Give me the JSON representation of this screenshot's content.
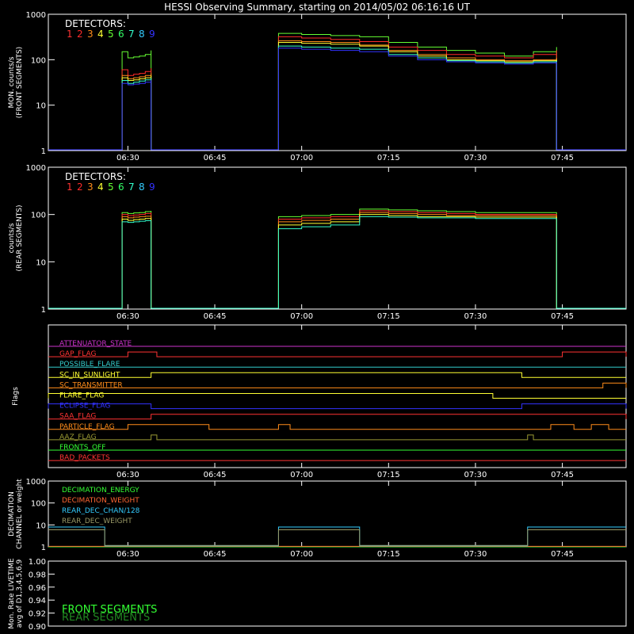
{
  "title": "HESSI Observing Summary, starting on 2014/05/02 06:16:16 UT",
  "time_ticks": [
    "06:30",
    "06:45",
    "07:00",
    "07:15",
    "07:30",
    "07:45"
  ],
  "detector_colors": [
    "#ff3333",
    "#ff2a2a",
    "#ff8c1a",
    "#ffff33",
    "#66ff33",
    "#33ff66",
    "#33ffcc",
    "#33ccff",
    "#3333ff"
  ],
  "detectors_label": "DETECTORS:",
  "detector_numbers": [
    "1",
    "2",
    "3",
    "4",
    "5",
    "6",
    "7",
    "8",
    "9"
  ],
  "chart_data": [
    {
      "type": "line",
      "panel": "front",
      "ylabel": [
        "MON. counts/s",
        "(FRONT SEGMENTS)"
      ],
      "yscale": "log",
      "ylim": [
        1,
        1000
      ],
      "ytick_labels": [
        "1",
        "10",
        "100",
        "1000"
      ],
      "xlim": [
        "06:16:16",
        "07:56"
      ],
      "x": [
        "06:29",
        "06:30",
        "06:31",
        "06:32",
        "06:33",
        "06:34",
        "06:57",
        "07:00",
        "07:05",
        "07:10",
        "07:15",
        "07:20",
        "07:25",
        "07:30",
        "07:35",
        "07:40",
        "07:44"
      ],
      "series": [
        {
          "values": [
            150,
            110,
            115,
            120,
            130,
            160,
            380,
            360,
            340,
            320,
            240,
            190,
            160,
            140,
            120,
            150,
            190
          ]
        },
        {
          "values": [
            60,
            45,
            48,
            50,
            55,
            65,
            320,
            300,
            280,
            250,
            190,
            160,
            130,
            120,
            110,
            130,
            160
          ]
        },
        {
          "values": [
            45,
            38,
            40,
            42,
            45,
            50,
            260,
            250,
            240,
            210,
            160,
            130,
            110,
            100,
            95,
            100,
            110
          ]
        },
        {
          "values": [
            40,
            35,
            36,
            38,
            40,
            45,
            240,
            230,
            220,
            200,
            150,
            120,
            100,
            95,
            90,
            95,
            100
          ]
        },
        {
          "values": [
            35,
            30,
            32,
            34,
            36,
            40,
            200,
            190,
            180,
            170,
            130,
            110,
            95,
            90,
            85,
            90,
            95
          ]
        },
        {
          "values": [
            30,
            28,
            29,
            30,
            32,
            36,
            180,
            170,
            160,
            150,
            120,
            100,
            90,
            85,
            80,
            85,
            90
          ]
        }
      ]
    },
    {
      "type": "line",
      "panel": "rear",
      "ylabel": [
        "counts/s",
        "(REAR SEGMENTS)"
      ],
      "yscale": "log",
      "ylim": [
        1,
        1000
      ],
      "ytick_labels": [
        "1",
        "10",
        "100",
        "1000"
      ],
      "xlim": [
        "06:16:16",
        "07:56"
      ],
      "x": [
        "06:29",
        "06:30",
        "06:31",
        "06:32",
        "06:33",
        "06:34",
        "06:57",
        "07:00",
        "07:05",
        "07:10",
        "07:15",
        "07:20",
        "07:25",
        "07:30",
        "07:35",
        "07:40",
        "07:44"
      ],
      "series": [
        {
          "values": [
            110,
            105,
            108,
            110,
            115,
            120,
            90,
            95,
            100,
            130,
            125,
            120,
            115,
            110,
            110,
            110,
            75
          ]
        },
        {
          "values": [
            100,
            95,
            98,
            100,
            105,
            110,
            80,
            85,
            90,
            120,
            115,
            110,
            105,
            100,
            100,
            100,
            65
          ]
        },
        {
          "values": [
            90,
            85,
            88,
            90,
            92,
            95,
            70,
            75,
            80,
            110,
            105,
            100,
            95,
            95,
            95,
            95,
            55
          ]
        },
        {
          "values": [
            80,
            75,
            78,
            80,
            82,
            85,
            60,
            65,
            70,
            100,
            95,
            90,
            90,
            88,
            88,
            88,
            45
          ]
        },
        {
          "values": [
            70,
            68,
            70,
            72,
            74,
            76,
            50,
            55,
            60,
            90,
            88,
            85,
            85,
            82,
            82,
            82,
            35
          ]
        }
      ]
    },
    {
      "type": "line",
      "panel": "flags",
      "ylabel": [
        "Flags"
      ],
      "xlim": [
        "06:16:16",
        "07:56"
      ],
      "flags": [
        {
          "name": "ATTENUATOR_STATE",
          "color": "#cc33cc",
          "segments": []
        },
        {
          "name": "GAP_FLAG",
          "color": "#ff3333",
          "segments": [
            [
              "06:30",
              "06:35"
            ],
            [
              "07:45",
              "07:56"
            ]
          ]
        },
        {
          "name": "POSSIBLE_FLARE",
          "color": "#33cccc",
          "segments": []
        },
        {
          "name": "SC_IN_SUNLIGHT",
          "color": "#ffff33",
          "segments": [
            [
              "06:34",
              "07:38"
            ]
          ]
        },
        {
          "name": "SC_TRANSMITTER",
          "color": "#ff8c1a",
          "segments": [
            [
              "07:52",
              "07:56"
            ]
          ]
        },
        {
          "name": "FLARE_FLAG",
          "color": "#ffff33",
          "segments": [
            [
              "06:16:16",
              "07:33"
            ]
          ]
        },
        {
          "name": "ECLIPSE_FLAG",
          "color": "#3333ff",
          "segments": [
            [
              "06:16:16",
              "06:34"
            ],
            [
              "07:38",
              "07:56"
            ]
          ]
        },
        {
          "name": "SAA_FLAG",
          "color": "#ff3333",
          "segments": [
            [
              "06:34",
              "07:56"
            ]
          ]
        },
        {
          "name": "PARTICLE_FLAG",
          "color": "#ff8c1a",
          "segments": [
            [
              "06:30",
              "06:44"
            ],
            [
              "06:56",
              "06:58"
            ],
            [
              "07:43",
              "07:47"
            ],
            [
              "07:50",
              "07:53"
            ]
          ]
        },
        {
          "name": "AAZ_FLAG",
          "color": "#999933",
          "segments": [
            [
              "06:34",
              "06:35"
            ],
            [
              "07:39",
              "07:40"
            ]
          ]
        },
        {
          "name": "FRONTS_OFF",
          "color": "#33ff33",
          "segments": []
        },
        {
          "name": "BAD_PACKETS",
          "color": "#ff3333",
          "segments": []
        }
      ]
    },
    {
      "type": "line",
      "panel": "decimation",
      "ylabel": [
        "DECIMATION",
        "CHANNEL or weight"
      ],
      "yscale": "log",
      "ylim": [
        1,
        1000
      ],
      "ytick_labels": [
        "1",
        "10",
        "100",
        "1000"
      ],
      "xlim": [
        "06:16:16",
        "07:56"
      ],
      "series": [
        {
          "name": "DECIMATION_ENERGY",
          "color": "#33ff33",
          "steps": [
            [
              "06:16:16",
              "06:26",
              1
            ],
            [
              "06:26",
              "06:56",
              1
            ],
            [
              "06:56",
              "07:10",
              1
            ],
            [
              "07:10",
              "07:39",
              1
            ],
            [
              "07:39",
              "07:56",
              1
            ]
          ]
        },
        {
          "name": "DECIMATION_WEIGHT",
          "color": "#ff6633",
          "steps": [
            [
              "06:16:16",
              "06:26",
              1
            ],
            [
              "06:26",
              "06:56",
              1
            ],
            [
              "06:56",
              "07:10",
              1
            ],
            [
              "07:10",
              "07:39",
              1
            ],
            [
              "07:39",
              "07:56",
              1
            ]
          ]
        },
        {
          "name": "REAR_DEC_CHAN/128",
          "color": "#33ccff",
          "steps": [
            [
              "06:16:16",
              "06:26",
              8
            ],
            [
              "06:26",
              "06:56",
              1
            ],
            [
              "06:56",
              "07:10",
              8
            ],
            [
              "07:10",
              "07:39",
              1
            ],
            [
              "07:39",
              "07:56",
              8
            ]
          ]
        },
        {
          "name": "REAR_DEC_WEIGHT",
          "color": "#999966",
          "steps": [
            [
              "06:16:16",
              "06:26",
              6
            ],
            [
              "06:26",
              "06:56",
              1
            ],
            [
              "06:56",
              "07:10",
              6
            ],
            [
              "07:10",
              "07:39",
              1
            ],
            [
              "07:39",
              "07:56",
              6
            ]
          ]
        }
      ]
    },
    {
      "type": "line",
      "panel": "livetime",
      "ylabel": [
        "Mon. Rate LIVETIME",
        "avg of D1,3,4,5,6,9"
      ],
      "ylim": [
        0.9,
        1.0
      ],
      "ytick_labels": [
        "0.90",
        "0.92",
        "0.94",
        "0.96",
        "0.98",
        "1.00"
      ],
      "xlim": [
        "06:16:16",
        "07:56"
      ],
      "series": [
        {
          "name": "FRONT SEGMENTS",
          "color": "#33ff33",
          "values": []
        },
        {
          "name": "REAR SEGMENTS",
          "color": "#228822",
          "values": []
        }
      ]
    }
  ]
}
